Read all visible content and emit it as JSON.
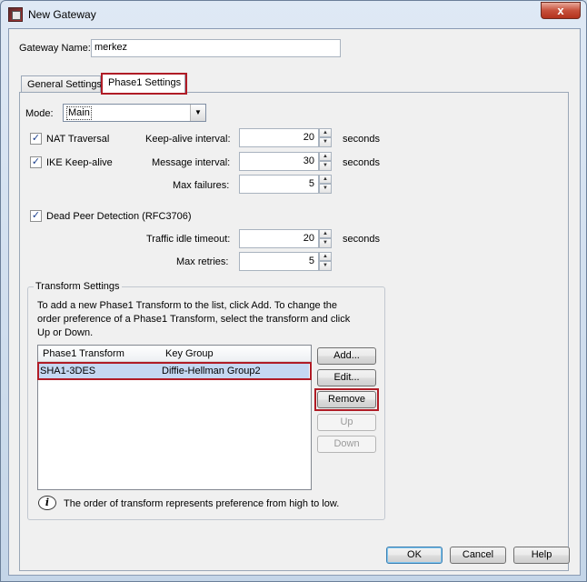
{
  "window": {
    "title": "New Gateway",
    "close_glyph": "x"
  },
  "gateway": {
    "name_label": "Gateway Name:",
    "name_value": "merkez"
  },
  "tabs": [
    {
      "label": "General Settings"
    },
    {
      "label": "Phase1 Settings"
    }
  ],
  "phase1": {
    "mode_label": "Mode:",
    "mode_value": "Main",
    "nat_traversal": {
      "label": "NAT Traversal",
      "checked": true
    },
    "ike_keepalive": {
      "label": "IKE Keep-alive",
      "checked": true
    },
    "dead_peer": {
      "label": "Dead Peer Detection (RFC3706)",
      "checked": true
    },
    "keepalive_interval": {
      "label": "Keep-alive interval:",
      "value": "20",
      "unit": "seconds"
    },
    "message_interval": {
      "label": "Message interval:",
      "value": "30",
      "unit": "seconds"
    },
    "max_failures": {
      "label": "Max failures:",
      "value": "5"
    },
    "traffic_idle_timeout": {
      "label": "Traffic idle timeout:",
      "value": "20",
      "unit": "seconds"
    },
    "max_retries": {
      "label": "Max retries:",
      "value": "5"
    }
  },
  "transform": {
    "legend": "Transform Settings",
    "desc_line1": "To add a new Phase1 Transform to the list, click Add. To change the",
    "desc_line2": "order preference of a Phase1 Transform, select the transform and click",
    "desc_line3": "Up or Down.",
    "columns": [
      "Phase1 Transform",
      "Key Group"
    ],
    "rows": [
      {
        "transform": "SHA1-3DES",
        "key_group": "Diffie-Hellman Group2"
      }
    ],
    "buttons": {
      "add": "Add...",
      "edit": "Edit...",
      "remove": "Remove",
      "up": "Up",
      "down": "Down"
    },
    "info_text": "The order of transform represents preference from high to low."
  },
  "footer": {
    "ok": "OK",
    "cancel": "Cancel",
    "help": "Help"
  },
  "colors": {
    "highlight": "#b01c26",
    "selection": "#c5d8f2"
  },
  "icons": {
    "app": "gateway-app-icon",
    "checkbox_mark": "✓",
    "spin_up": "▲",
    "spin_down": "▼",
    "combo_arrow": "▼",
    "info": "i"
  }
}
